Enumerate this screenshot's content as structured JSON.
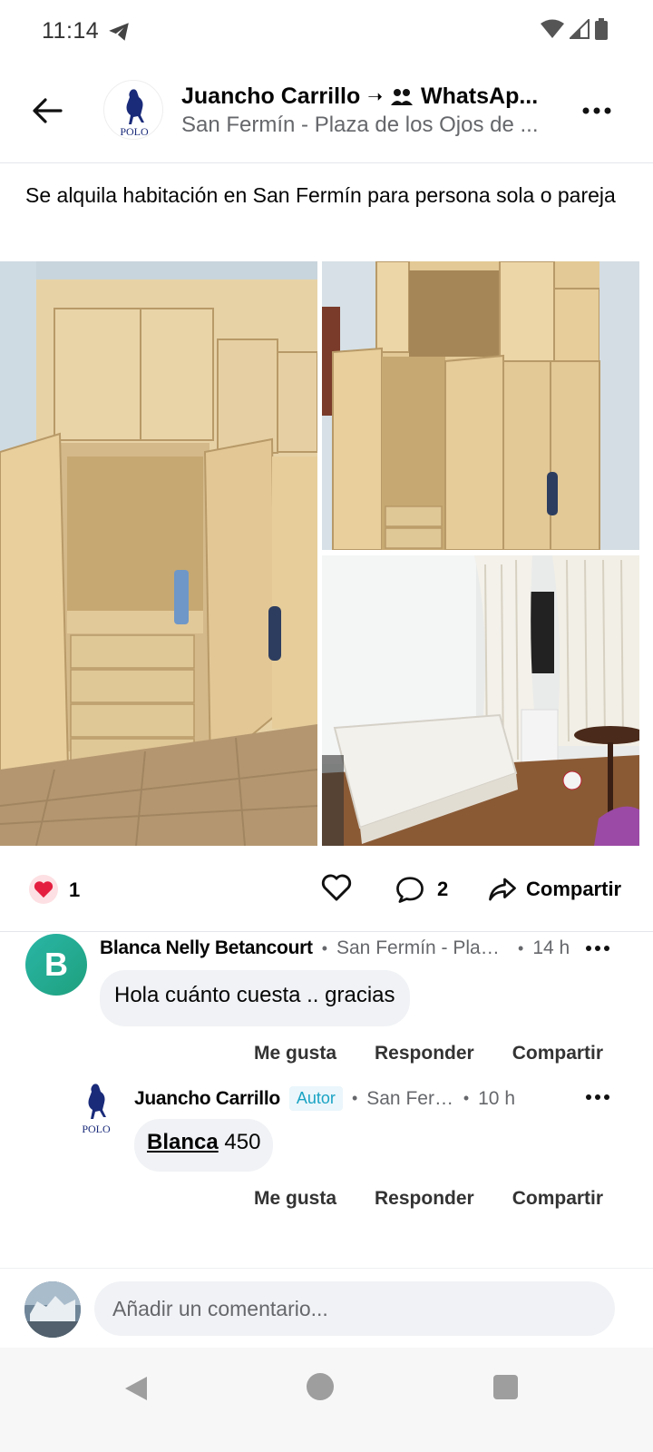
{
  "status_bar": {
    "time": "11:14",
    "icons": [
      "telegram-icon",
      "wifi-icon",
      "signal-icon",
      "battery-icon"
    ]
  },
  "header": {
    "author": "Juancho Carrillo",
    "arrow": "➝",
    "group": "WhatsAp...",
    "location": "San Fermín - Plaza de los Ojos de ...",
    "avatar_text": "POLO"
  },
  "post": {
    "text": "Se alquila habitación en San Fermín para persona sola o pareja"
  },
  "reactions": {
    "count": "1",
    "comments_count": "2",
    "share_label": "Compartir"
  },
  "comments": [
    {
      "avatar_letter": "B",
      "name": "Blanca Nelly Betancourt",
      "location": "San Fermín - Plaza...",
      "time": "14 h",
      "text": "Hola cuánto cuesta .. gracias",
      "actions": {
        "like": "Me gusta",
        "reply": "Responder",
        "share": "Compartir"
      }
    },
    {
      "avatar_text": "POLO",
      "name": "Juancho Carrillo",
      "badge": "Autor",
      "location": "San Fermín - ...",
      "time": "10 h",
      "mention": "Blanca",
      "text": " 450",
      "actions": {
        "like": "Me gusta",
        "reply": "Responder",
        "share": "Compartir"
      }
    }
  ],
  "composer": {
    "placeholder": "Añadir un comentario..."
  },
  "colors": {
    "accent_badge": "#1aa3c4",
    "avatar_b": "#29b6a6",
    "heart": "#e41e3f"
  }
}
